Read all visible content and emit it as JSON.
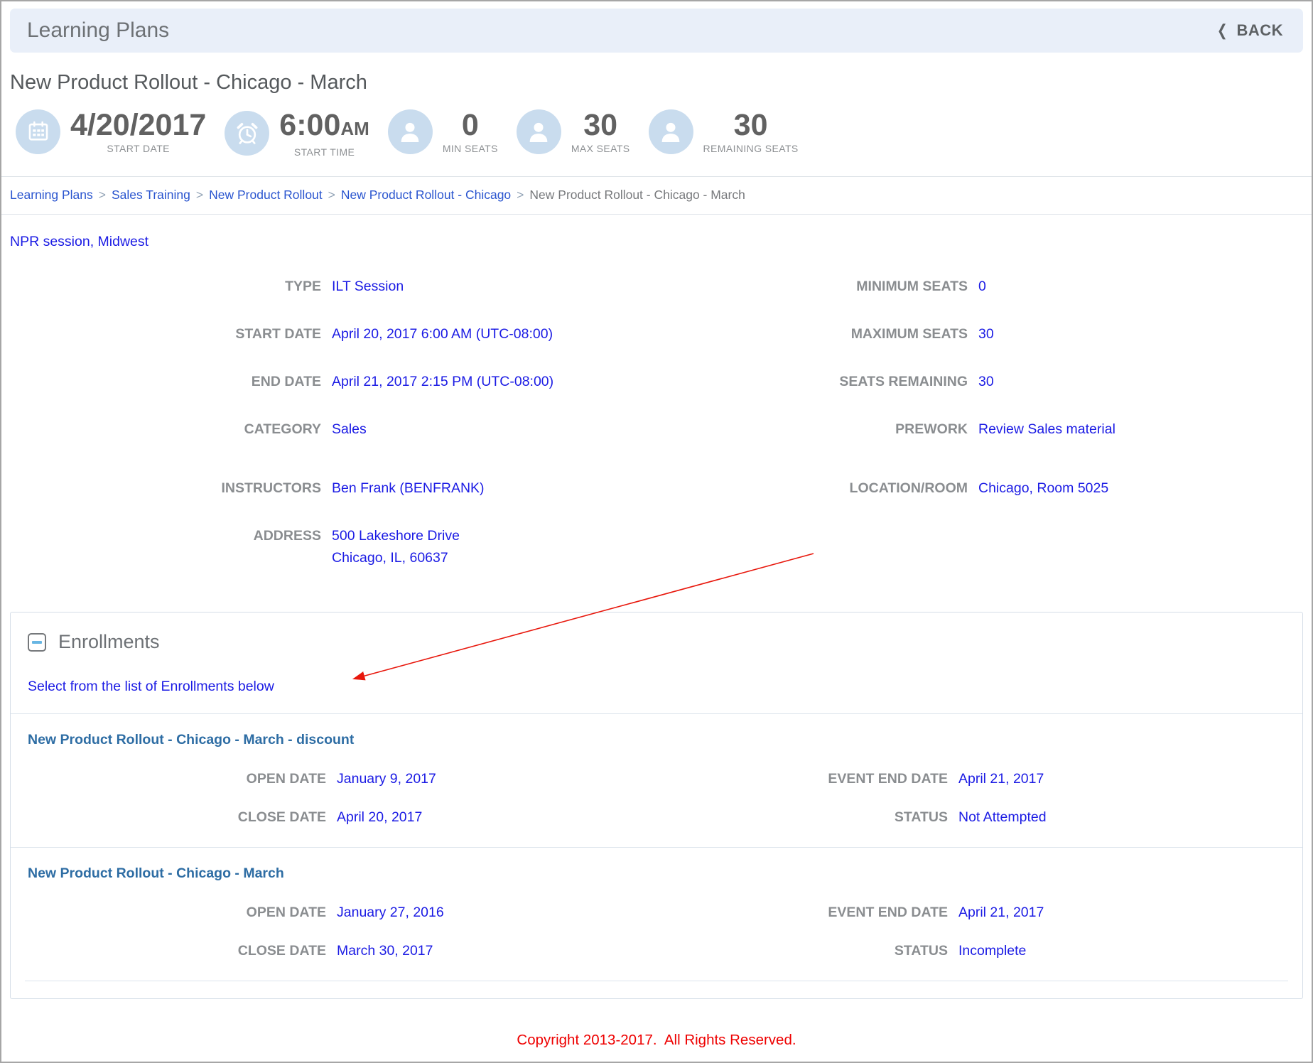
{
  "header": {
    "title": "Learning Plans",
    "back_label": "BACK",
    "back_chevron": "❮"
  },
  "page": {
    "title": "New Product Rollout - Chicago - March"
  },
  "stats": [
    {
      "icon": "calendar-icon",
      "value": "4/20/2017",
      "label": "START DATE"
    },
    {
      "icon": "alarm-clock-icon",
      "value": "6:00",
      "suffix": "AM",
      "label": "START TIME"
    },
    {
      "icon": "person-icon",
      "value": "0",
      "label": "MIN SEATS"
    },
    {
      "icon": "person-icon",
      "value": "30",
      "label": "MAX SEATS"
    },
    {
      "icon": "person-icon",
      "value": "30",
      "label": "REMAINING SEATS"
    }
  ],
  "breadcrumb": {
    "separator": ">",
    "links": [
      "Learning Plans",
      "Sales Training",
      "New Product Rollout",
      "New Product Rollout - Chicago"
    ],
    "current": "New Product Rollout - Chicago - March"
  },
  "session": {
    "name": "NPR session, Midwest"
  },
  "details": {
    "left": [
      {
        "label": "TYPE",
        "value": "ILT Session"
      },
      {
        "label": "START DATE",
        "value": "April 20, 2017 6:00 AM (UTC-08:00)"
      },
      {
        "label": "END DATE",
        "value": "April 21, 2017 2:15 PM (UTC-08:00)"
      },
      {
        "label": "CATEGORY",
        "value": "Sales"
      },
      {
        "label": "INSTRUCTORS",
        "value": "Ben Frank (BENFRANK)"
      },
      {
        "label": "ADDRESS",
        "value": "500 Lakeshore Drive",
        "value2": "Chicago, IL, 60637"
      }
    ],
    "right": [
      {
        "label": "MINIMUM SEATS",
        "value": "0"
      },
      {
        "label": "MAXIMUM SEATS",
        "value": "30"
      },
      {
        "label": "SEATS REMAINING",
        "value": "30"
      },
      {
        "label": "PREWORK",
        "value": "Review Sales material"
      },
      {
        "label": "LOCATION/ROOM",
        "value": "Chicago, Room 5025"
      }
    ]
  },
  "enrollments": {
    "title": "Enrollments",
    "instruction": "Select from the list of Enrollments below",
    "labels": {
      "open": "OPEN DATE",
      "close": "CLOSE DATE",
      "event_end": "EVENT END DATE",
      "status": "STATUS"
    },
    "items": [
      {
        "title": "New Product Rollout - Chicago - March - discount",
        "open_date": "January 9, 2017",
        "close_date": "April 20, 2017",
        "event_end_date": "April 21, 2017",
        "status": "Not Attempted"
      },
      {
        "title": "New Product Rollout - Chicago - March",
        "open_date": "January 27, 2016",
        "close_date": "March 30, 2017",
        "event_end_date": "April 21, 2017",
        "status": "Incomplete"
      }
    ]
  },
  "footer": {
    "copyright": "Copyright 2013-2017.  All Rights Reserved."
  },
  "colors": {
    "header_bar_bg": "#e9eff9",
    "heading_gray": "#6d7175",
    "label_gray": "#8a8d90",
    "value_blue": "#1b1be4",
    "breadcrumb_link_blue": "#2a55cf",
    "enrollment_title_blue": "#2e6da4",
    "icon_circle_blue": "#c9dcee",
    "collapse_minus_blue": "#68b6e3",
    "footer_red": "#ee0000",
    "arrow_red": "#e8170c"
  }
}
